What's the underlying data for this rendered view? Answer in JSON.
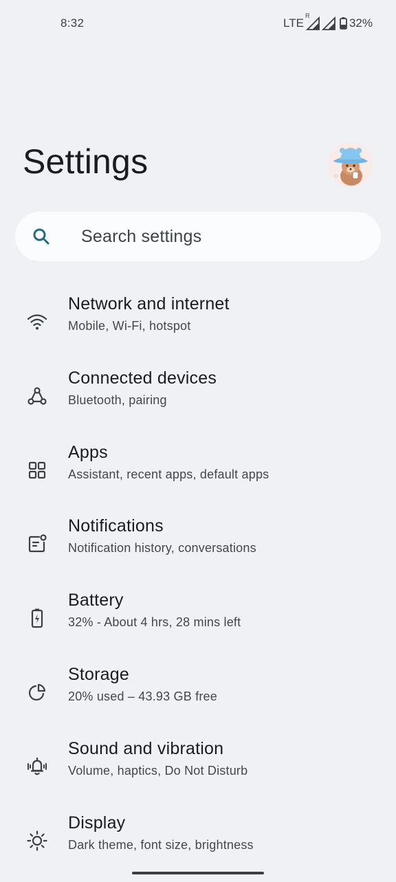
{
  "status_bar": {
    "time": "8:32",
    "network": "LTE",
    "roaming_indicator": "R",
    "battery": "32%",
    "icons": [
      "signal-roaming-icon",
      "signal-icon",
      "battery-icon"
    ]
  },
  "header": {
    "title": "Settings",
    "avatar_icon": "bear-avatar"
  },
  "search": {
    "placeholder": "Search settings",
    "icon": "search-icon",
    "accent_color": "#1e6e7a"
  },
  "items": [
    {
      "icon": "wifi-icon",
      "title": "Network and internet",
      "subtitle": "Mobile, Wi-Fi, hotspot"
    },
    {
      "icon": "connected-devices-icon",
      "title": "Connected devices",
      "subtitle": "Bluetooth, pairing"
    },
    {
      "icon": "apps-grid-icon",
      "title": "Apps",
      "subtitle": "Assistant, recent apps, default apps"
    },
    {
      "icon": "notifications-icon",
      "title": "Notifications",
      "subtitle": "Notification history, conversations"
    },
    {
      "icon": "battery-icon",
      "title": "Battery",
      "subtitle": "32% - About 4 hrs, 28 mins left"
    },
    {
      "icon": "storage-icon",
      "title": "Storage",
      "subtitle": "20% used – 43.93 GB free"
    },
    {
      "icon": "sound-vibration-icon",
      "title": "Sound and vibration",
      "subtitle": "Volume, haptics, Do Not Disturb"
    },
    {
      "icon": "display-brightness-icon",
      "title": "Display",
      "subtitle": "Dark theme, font size, brightness"
    }
  ]
}
